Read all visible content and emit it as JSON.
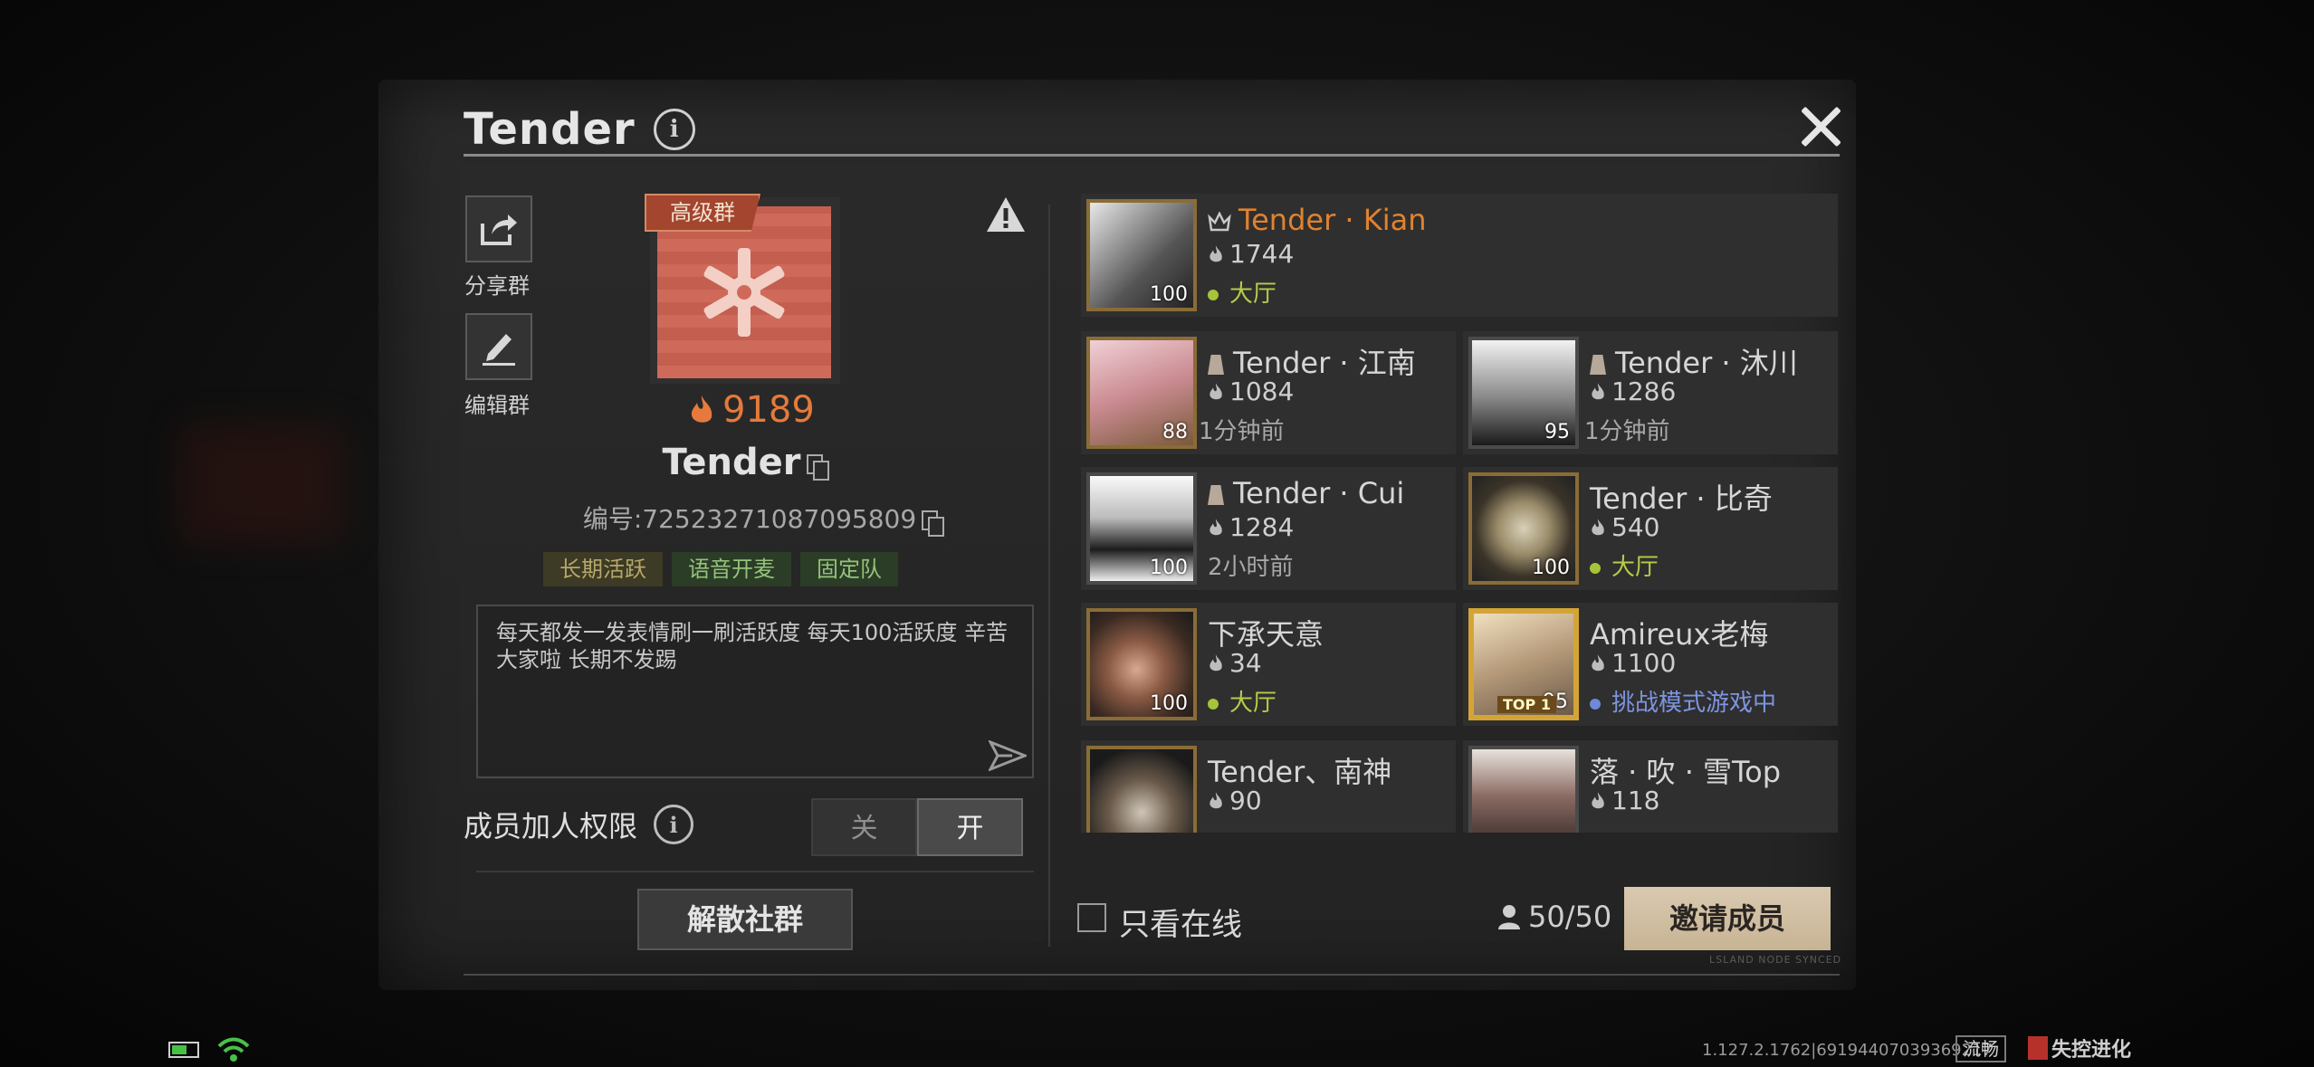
{
  "header": {
    "title": "Tender"
  },
  "sidebar": {
    "share_label": "分享群",
    "edit_label": "编辑群"
  },
  "group": {
    "tier": "高级群",
    "heat": "9189",
    "name": "Tender",
    "id_text": "编号:72523271087095809",
    "tags": [
      "长期活跃",
      "语音开麦",
      "固定队"
    ],
    "description": "每天都发一发表情刷一刷活跃度 每天100活跃度  辛苦大家啦 长期不发踢"
  },
  "permission": {
    "label": "成员加人权限",
    "off_label": "关",
    "on_label": "开",
    "selected": "开"
  },
  "actions": {
    "disband_label": "解散社群",
    "invite_label": "邀请成员"
  },
  "members": [
    {
      "name": "Tender · Kian",
      "heat": "1744",
      "status": "大厅",
      "level": "100",
      "role": "owner"
    },
    {
      "name": "Tender · 江南",
      "heat": "1084",
      "status": "1分钟前",
      "level": "88",
      "role": "admin"
    },
    {
      "name": "Tender · 沐川",
      "heat": "1286",
      "status": "1分钟前",
      "level": "95",
      "role": "admin"
    },
    {
      "name": "Tender · Cui",
      "heat": "1284",
      "status": "2小时前",
      "level": "100",
      "role": "admin"
    },
    {
      "name": "Tender · 比奇",
      "heat": "540",
      "status": "大厅",
      "level": "100",
      "role": "member"
    },
    {
      "name": "下承天意",
      "heat": "34",
      "status": "大厅",
      "level": "100",
      "role": "member"
    },
    {
      "name": "Amireux老梅",
      "heat": "1100",
      "status": "挑战模式游戏中",
      "level": "95",
      "role": "member",
      "frame_label": "TOP 1"
    },
    {
      "name": "Tender、南神",
      "heat": "90",
      "status": "",
      "level": "",
      "role": "member"
    },
    {
      "name": "落 · 吹 · 雪Top",
      "heat": "118",
      "status": "",
      "level": "",
      "role": "member"
    }
  ],
  "filter": {
    "online_only_label": "只看在线",
    "checked": false
  },
  "member_count": "50/50",
  "footer": {
    "synced_text": "LSLAND NODE SYNCED",
    "version": "1.127.2.1762|6919440703936921​7",
    "fluency": "流畅",
    "brand": "失控进化"
  },
  "colors": {
    "owner_name": "#e0822f",
    "heat": "#e57a3c",
    "lobby": "#b6cc49",
    "in_game": "#7d95e0",
    "invite_button": "#d4c3a6"
  },
  "icons": [
    "info-icon",
    "close-icon",
    "share-icon",
    "edit-icon",
    "warning-icon",
    "flame-icon",
    "copy-icon",
    "send-icon",
    "crown-icon",
    "person-icon",
    "battery-icon",
    "wifi-icon"
  ]
}
